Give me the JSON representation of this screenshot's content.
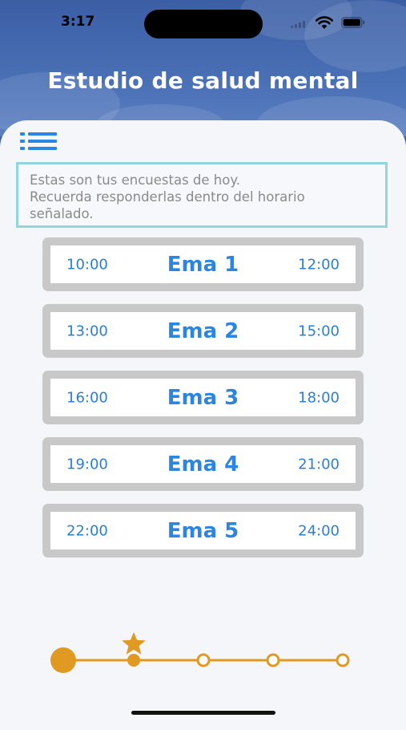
{
  "status_bar": {
    "time": "3:17"
  },
  "header": {
    "title": "Estudio de salud mental"
  },
  "notice": {
    "lines": [
      "Estas son tus encuestas de hoy.",
      "Recuerda responderlas dentro del horario",
      "señalado."
    ]
  },
  "emas": [
    {
      "start": "10:00",
      "name": "Ema 1",
      "end": "12:00"
    },
    {
      "start": "13:00",
      "name": "Ema 2",
      "end": "15:00"
    },
    {
      "start": "16:00",
      "name": "Ema 3",
      "end": "18:00"
    },
    {
      "start": "19:00",
      "name": "Ema 4",
      "end": "21:00"
    },
    {
      "start": "22:00",
      "name": "Ema 5",
      "end": "24:00"
    }
  ],
  "progress": {
    "total_steps": 5,
    "current_step": 1,
    "starred_step": 1
  },
  "colors": {
    "header_blue": "#3f63a6",
    "accent_blue": "#2a86e0",
    "notice_border": "#8fd6df",
    "card_border": "#c8c8c8",
    "progress_orange": "#e09a22"
  },
  "icons": {
    "menu": "list-menu-icon",
    "progress_star": "star-icon",
    "wifi": "wifi-icon",
    "battery": "battery-icon",
    "signal": "cellular-signal-icon"
  }
}
